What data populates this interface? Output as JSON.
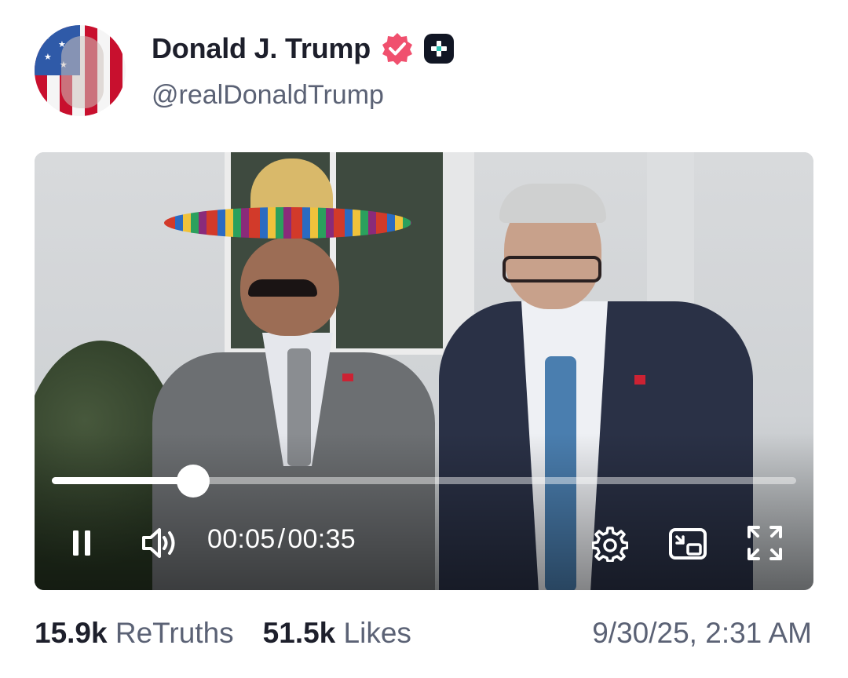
{
  "post": {
    "author_name": "Donald J. Trump",
    "author_handle": "@realDonaldTrump",
    "verified_icon": "verified-badge-icon",
    "plus_icon": "plus-badge-icon",
    "colors": {
      "verified": "#f0506e",
      "text": "#1d1f2b",
      "muted": "#5b6275"
    }
  },
  "video": {
    "current_time": "00:05",
    "separator": "/",
    "duration": "00:35",
    "progress": 0.19,
    "state": "playing",
    "icons": [
      "pause-icon",
      "volume-icon",
      "settings-icon",
      "picture-in-picture-icon",
      "fullscreen-icon"
    ]
  },
  "stats": {
    "retruths_count": "15.9k",
    "retruths_label": "ReTruths",
    "likes_count": "51.5k",
    "likes_label": "Likes",
    "timestamp": "9/30/25, 2:31 AM"
  }
}
